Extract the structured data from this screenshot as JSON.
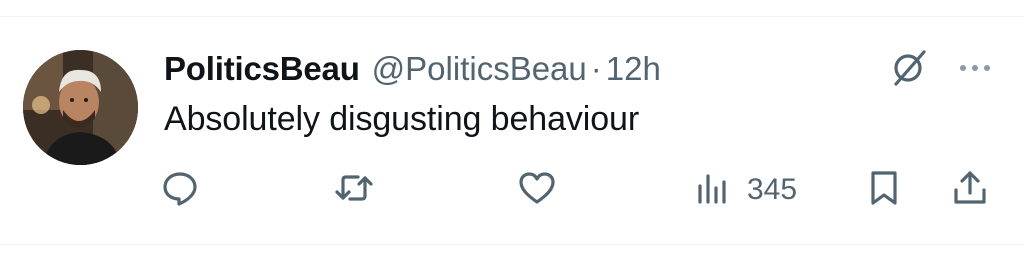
{
  "tweet": {
    "author_name": "PoliticsBeau",
    "handle": "@PoliticsBeau",
    "separator": "·",
    "time": "12h",
    "text": "Absolutely disgusting behaviour",
    "views_count": "345"
  },
  "icons": {
    "grok": "grok-icon",
    "more": "more-icon",
    "reply": "reply-icon",
    "retweet": "retweet-icon",
    "like": "heart-icon",
    "views": "views-icon",
    "bookmark": "bookmark-icon",
    "share": "share-icon"
  },
  "colors": {
    "text_primary": "#0f1419",
    "text_secondary": "#536471",
    "divider": "#eff3f4"
  }
}
